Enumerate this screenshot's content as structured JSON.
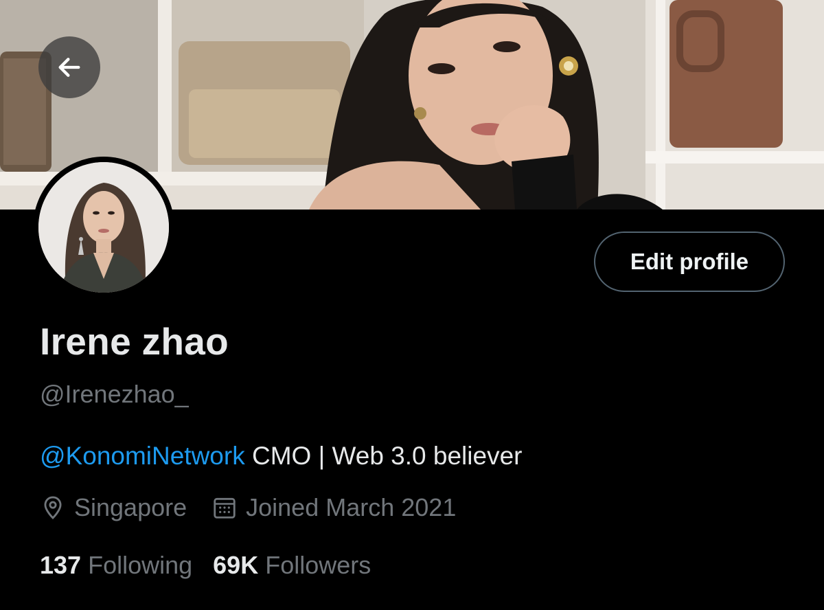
{
  "header": {
    "back_icon": "arrow-left-icon",
    "banner_image": "profile-banner-photo"
  },
  "profile": {
    "avatar": "profile-avatar-photo",
    "name": "Irene zhao",
    "handle": "@Irenezhao_",
    "edit_button_label": "Edit profile",
    "bio_mention": "@KonomiNetwork",
    "bio_text": " CMO | Web 3.0 believer",
    "location_icon": "location-pin-icon",
    "location": "Singapore",
    "joined_icon": "calendar-icon",
    "joined": "Joined March 2021",
    "following_count": "137",
    "following_label": "Following",
    "followers_count": "69K",
    "followers_label": "Followers"
  },
  "colors": {
    "background": "#000000",
    "text_primary": "#e7e9ea",
    "text_secondary": "#71767b",
    "link": "#1d9bf0",
    "button_border": "#536471"
  }
}
